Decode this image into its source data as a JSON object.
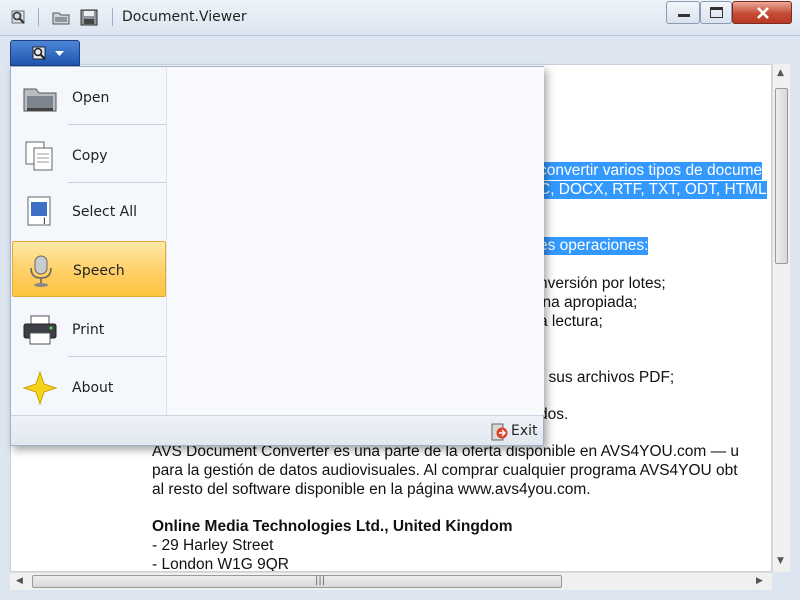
{
  "window": {
    "title": "Document.Viewer"
  },
  "quick_access": {
    "icons": [
      "app-logo-icon",
      "open-folder-icon",
      "save-icon"
    ]
  },
  "app_menu": {
    "items": [
      {
        "label": "Open",
        "icon": "open-folder-icon"
      },
      {
        "label": "Copy",
        "icon": "copy-icon"
      },
      {
        "label": "Select All",
        "icon": "select-all-icon"
      },
      {
        "label": "Speech",
        "icon": "microphone-icon",
        "active": true
      },
      {
        "label": "Print",
        "icon": "printer-icon"
      },
      {
        "label": "About",
        "icon": "star-icon"
      }
    ],
    "exit_label": "Exit"
  },
  "document": {
    "lines": [
      "convertir varios tipos de docume",
      "C, DOCX, RTF, TXT, ODT, HTML",
      "es operaciones:",
      "nversión por lotes;",
      "ina apropiada;",
      "a lectura;",
      "r sus archivos PDF;",
      "dos.",
      "AVS Document Converter es una parte de la oferta disponible en AVS4YOU.com — u",
      "para la gestión de datos audiovisuales. Al comprar cualquier programa AVS4YOU obt",
      "al resto del software disponible en la página www.avs4you.com.",
      "Online Media Technologies Ltd., United Kingdom",
      "- 29 Harley Street",
      "- London W1G 9QR"
    ]
  },
  "colors": {
    "selection": "#3399ff",
    "menu_highlight": "#ffd066",
    "menu_button": "#2a63bf"
  }
}
